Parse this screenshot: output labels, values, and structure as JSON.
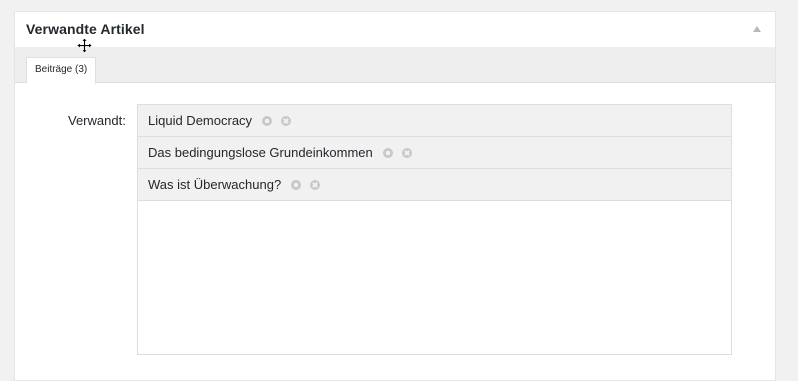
{
  "metabox": {
    "title": "Verwandte Artikel"
  },
  "tabs": [
    {
      "label": "Beiträge (3)"
    }
  ],
  "field": {
    "label": "Verwandt:"
  },
  "related_items": [
    {
      "title": "Liquid Democracy"
    },
    {
      "title": "Das bedingungslose Grundeinkommen"
    },
    {
      "title": "Was ist Überwachung?"
    }
  ],
  "icons": {
    "collapse": "triangle-up-icon",
    "cursor": "move-cursor-icon",
    "item_handle": "drag-handle-icon",
    "item_remove": "remove-icon"
  },
  "colors": {
    "panel_bg": "#ffffff",
    "page_bg": "#f1f1f1",
    "item_bg": "#f1f1f1",
    "icon_grey": "#c8c8c8"
  }
}
